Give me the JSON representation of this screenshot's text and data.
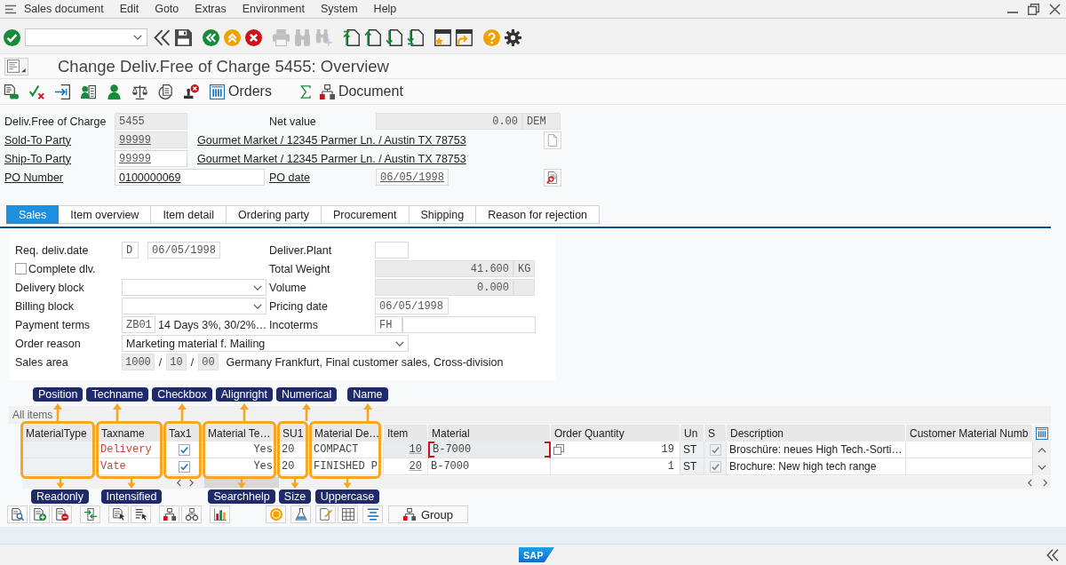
{
  "menu_bar": {
    "items": [
      "Sales document",
      "Edit",
      "Goto",
      "Extras",
      "Environment",
      "System",
      "Help"
    ]
  },
  "system_toolbar": [
    {
      "kind": "enter",
      "disabled": false
    },
    {
      "kind": "command_field",
      "disabled": false
    },
    {
      "kind": "collapse",
      "disabled": false
    },
    {
      "kind": "save",
      "disabled": false
    },
    {
      "kind": "back",
      "disabled": false
    },
    {
      "kind": "exit",
      "disabled": false
    },
    {
      "kind": "cancel",
      "disabled": false
    },
    {
      "kind": "print",
      "disabled": true
    },
    {
      "kind": "find",
      "disabled": true
    },
    {
      "kind": "find_next",
      "disabled": true
    },
    {
      "kind": "first_page",
      "disabled": false
    },
    {
      "kind": "previous_page",
      "disabled": false
    },
    {
      "kind": "next_page",
      "disabled": false
    },
    {
      "kind": "last_page",
      "disabled": false
    },
    {
      "kind": "new_session",
      "disabled": false
    },
    {
      "kind": "shortcut",
      "disabled": false
    },
    {
      "kind": "help",
      "disabled": false
    },
    {
      "kind": "settings",
      "disabled": false
    }
  ],
  "title": "Change Deliv.Free of Charge 5455: Overview",
  "application_toolbar": {
    "orders_button": "Orders",
    "document_button": "Document"
  },
  "header": {
    "document": {
      "label": "Deliv.Free of Charge",
      "link": false,
      "value": "5455",
      "readonly": true
    },
    "net_value": {
      "label": "Net value",
      "link": false,
      "value": "0.00",
      "currency": "DEM",
      "readonly": true
    },
    "sold_to_party": {
      "label": "Sold-To Party",
      "link": true,
      "value": "99999",
      "readonly": true,
      "address": "Gourmet Market / 12345 Parmer Ln. / Austin TX 78753"
    },
    "ship_to_party": {
      "label": "Ship-To Party",
      "link": true,
      "value": "99999",
      "readonly": false,
      "address": "Gourmet Market / 12345 Parmer Ln. / Austin TX 78753"
    },
    "po_number": {
      "label": "PO Number",
      "link": true,
      "value": "0100000069",
      "readonly": false
    },
    "po_date": {
      "label": "PO date",
      "link": true,
      "value": "06/05/1998",
      "readonly": false
    }
  },
  "tabs": [
    {
      "label": "Sales",
      "selected": true
    },
    {
      "label": "Item overview",
      "selected": false
    },
    {
      "label": "Item detail",
      "selected": false
    },
    {
      "label": "Ordering party",
      "selected": false
    },
    {
      "label": "Procurement",
      "selected": false
    },
    {
      "label": "Shipping",
      "selected": false
    },
    {
      "label": "Reason for rejection",
      "selected": false
    }
  ],
  "sales_tab": {
    "req_deliv_date": {
      "label": "Req. deliv.date",
      "date_type": "D",
      "value": "06/05/1998",
      "readonly": false
    },
    "deliver_plant": {
      "label": "Deliver.Plant",
      "readonly": false
    },
    "complete_dlv": {
      "label": "Complete dlv.",
      "checked": false
    },
    "total_weight": {
      "label": "Total Weight",
      "value": "41.600",
      "unit": "KG",
      "readonly": true
    },
    "delivery_block": {
      "label": "Delivery block"
    },
    "volume": {
      "label": "Volume",
      "value": "0.000",
      "readonly": true
    },
    "billing_block": {
      "label": "Billing block"
    },
    "pricing_date": {
      "label": "Pricing date",
      "value": "06/05/1998",
      "readonly": false
    },
    "payment_terms": {
      "label": "Payment terms",
      "value": "ZB01",
      "description": "14 Days 3%, 30/2%…",
      "readonly": false
    },
    "incoterms": {
      "label": "Incoterms",
      "value": "FH",
      "readonly": false
    },
    "order_reason": {
      "label": "Order reason",
      "value": "Marketing material f. Mailing"
    },
    "sales_area": {
      "label": "Sales area",
      "values": [
        "1000",
        "10",
        "00"
      ],
      "separator": "/",
      "description": "Germany Frankfurt, Final customer sales, Cross-division",
      "readonly": true
    }
  },
  "items_table": {
    "title": "All items",
    "columns": [
      {
        "label": "MaterialType",
        "readonly": true,
        "annotation_above": "Position",
        "annotation_below": "Readonly"
      },
      {
        "label": "Taxname",
        "readonly": false,
        "annotation_above": "Techname",
        "annotation_below": "Intensified"
      },
      {
        "label": "Tax1",
        "readonly": false,
        "annotation_above": "Checkbox"
      },
      {
        "label": "Material Te…",
        "readonly": false,
        "annotation_above": "Alignright",
        "annotation_below": "Searchhelp"
      },
      {
        "label": "SU1",
        "readonly": false,
        "annotation_above": "Numerical",
        "annotation_below": "Size"
      },
      {
        "label": "Material De…",
        "readonly": false,
        "annotation_above": "Name",
        "annotation_below": "Uppercase"
      },
      {
        "label": "Item",
        "readonly": false
      },
      {
        "label": "Material",
        "readonly": false
      },
      {
        "label": "Order Quantity",
        "readonly": false
      },
      {
        "label": "Un",
        "readonly": true
      },
      {
        "label": "S",
        "readonly": true
      },
      {
        "label": "Description",
        "readonly": false
      },
      {
        "label": "Customer Material Numb",
        "readonly": false
      }
    ],
    "rows": [
      {
        "focused": true,
        "taxname": "Delivery",
        "tax1": true,
        "material_text": "Yes",
        "su1": "20",
        "material_description": "COMPACT",
        "item": "10",
        "material": "B-7000",
        "order_quantity": "19",
        "unit": "ST",
        "s": true,
        "description": "Broschüre: neues High Tech.-Sorti…"
      },
      {
        "focused": false,
        "taxname": "Vate",
        "tax1": true,
        "material_text": "Yes",
        "su1": "20",
        "material_description": "FINISHED P",
        "item": "20",
        "material": "B-7000",
        "order_quantity": "1",
        "unit": "ST",
        "s": true,
        "description": "Brochure: New high tech range"
      }
    ]
  },
  "table_toolbar": {
    "group_button": "Group"
  },
  "status_bar": {
    "logo": "SAP"
  }
}
